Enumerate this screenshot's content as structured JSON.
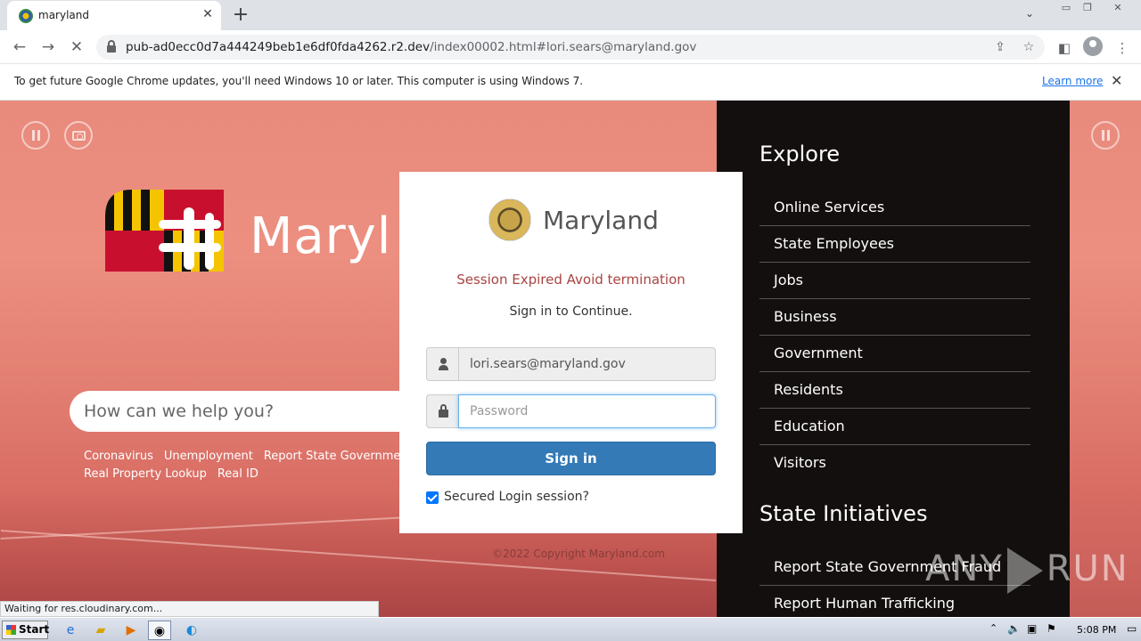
{
  "browser": {
    "tab_title": "maryland",
    "url_host": "pub-ad0ecc0d7a444249beb1e6df0fda4262.r2.dev",
    "url_path": "/index00002.html#lori.sears@maryland.gov",
    "tab_close_glyph": "✕",
    "new_tab_glyph": "+"
  },
  "infobar": {
    "text": "To get future Google Chrome updates, you'll need Windows 10 or later. This computer is using Windows 7.",
    "link": "Learn more"
  },
  "page": {
    "brand": "Maryl",
    "search_placeholder": "How can we help you?",
    "quick_links": [
      "Coronavirus",
      "Unemployment",
      "Report State Governmen",
      "Real Property Lookup",
      "Real ID"
    ],
    "copyright": "©2022 Copyright Maryland.com"
  },
  "sidebar": {
    "explore_heading": "Explore",
    "explore_items": [
      "Online Services",
      "State Employees",
      "Jobs",
      "Business",
      "Government",
      "Residents",
      "Education",
      "Visitors"
    ],
    "initiatives_heading": "State Initiatives",
    "initiative_items": [
      "Report State Government Fraud",
      "Report Human Trafficking"
    ]
  },
  "modal": {
    "brand": "Maryland",
    "expired_message": "Session Expired Avoid termination",
    "subtitle": "Sign in to Continue.",
    "email_value": "lori.sears@maryland.gov",
    "password_placeholder": "Password",
    "signin_label": "Sign in",
    "checkbox_label": "Secured Login session?",
    "checkbox_checked": true
  },
  "status_bar": "Waiting for res.cloudinary.com...",
  "watermark": {
    "left": "ANY",
    "right": "RUN"
  },
  "taskbar": {
    "start_label": "Start",
    "clock": "5:08 PM"
  },
  "colors": {
    "error_text": "#a94442",
    "primary_button": "#337ab7",
    "sidebar_bg": "#140f0f"
  }
}
